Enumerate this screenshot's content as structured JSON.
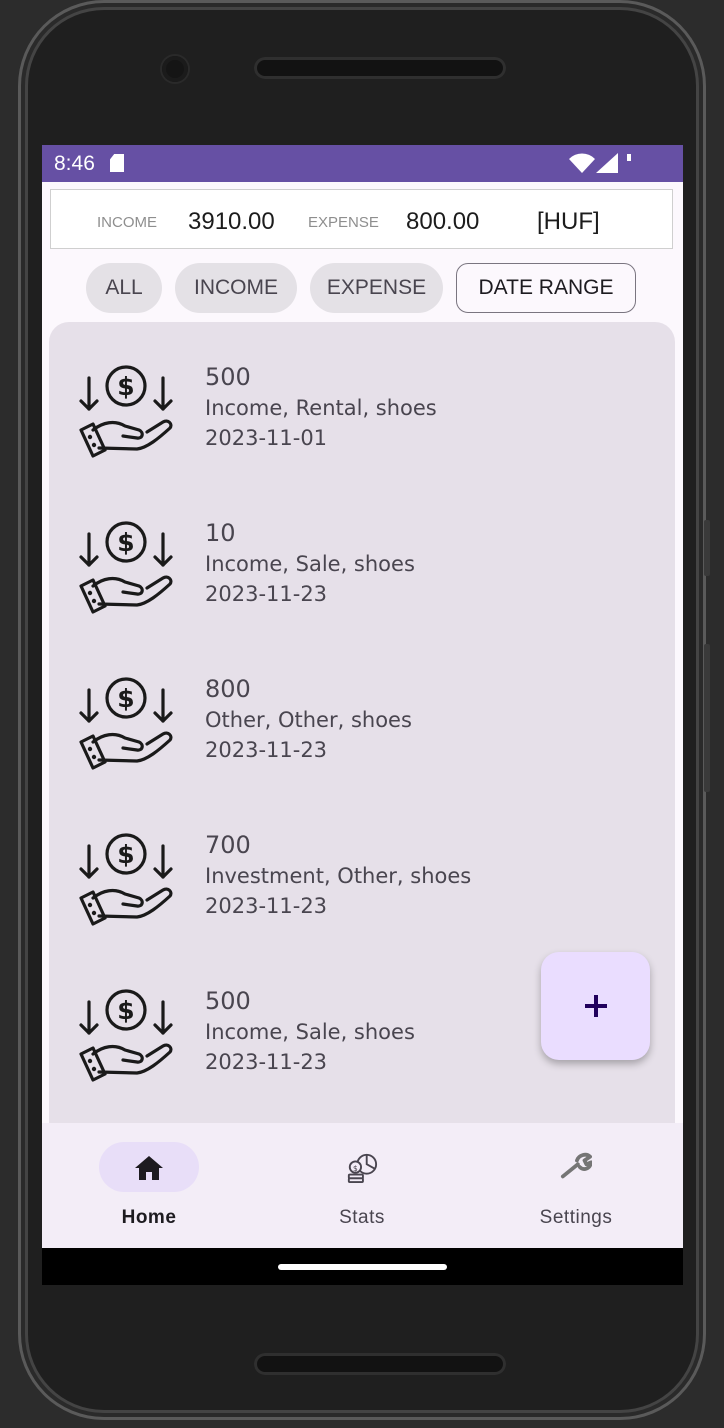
{
  "status_bar": {
    "time": "8:46"
  },
  "summary": {
    "income_label": "INCOME",
    "income_value": "3910.00",
    "expense_label": "EXPENSE",
    "expense_value": "800.00",
    "currency": "[HUF]"
  },
  "filters": {
    "all": "ALL",
    "income": "INCOME",
    "expense": "EXPENSE",
    "date_range": "DATE RANGE"
  },
  "transactions": [
    {
      "amount": "500",
      "details": "Income, Rental, shoes",
      "date": "2023-11-01",
      "icon": "money-hand-icon"
    },
    {
      "amount": "10",
      "details": "Income, Sale, shoes",
      "date": "2023-11-23",
      "icon": "money-hand-icon"
    },
    {
      "amount": "800",
      "details": "Other, Other, shoes",
      "date": "2023-11-23",
      "icon": "money-hand-icon"
    },
    {
      "amount": "700",
      "details": "Investment, Other, shoes",
      "date": "2023-11-23",
      "icon": "money-hand-icon"
    },
    {
      "amount": "500",
      "details": "Income, Sale, shoes",
      "date": "2023-11-23",
      "icon": "money-hand-icon"
    }
  ],
  "fab": {
    "icon": "plus-icon"
  },
  "bottom_nav": [
    {
      "label": "Home",
      "icon": "home-icon",
      "active": true
    },
    {
      "label": "Stats",
      "icon": "stats-icon",
      "active": false
    },
    {
      "label": "Settings",
      "icon": "wrench-icon",
      "active": false
    }
  ],
  "colors": {
    "status_bar": "#6650a4",
    "list_background": "#e6e0e9",
    "fab_background": "#eaddff",
    "nav_pill": "#e8def8",
    "nav_background": "#f3edf7"
  }
}
